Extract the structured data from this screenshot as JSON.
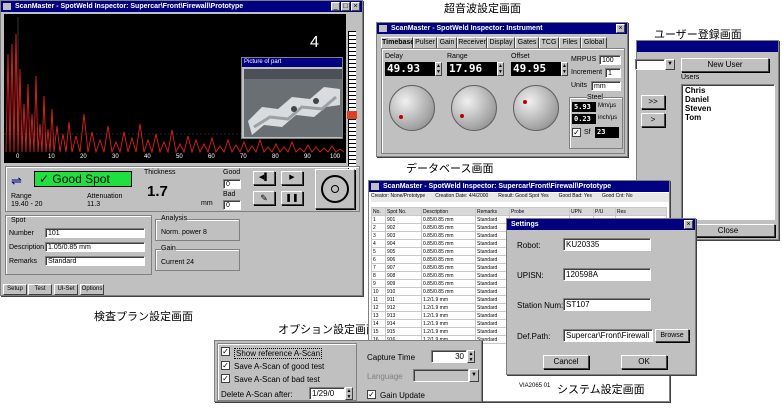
{
  "captions": {
    "ultrasonic": "超音波設定画面",
    "user": "ユーザー登録画面",
    "database": "データベース画面",
    "inspection": "検査プラン設定画面",
    "options": "オプション設定画面",
    "system": "システム設定画面"
  },
  "main": {
    "title": "ScanMaster - SpotWeld Inspector: Supercar\\Front\\Firewall\\Prototype",
    "spot_number": "4",
    "picture_title": "Picture of part",
    "x_ticks": [
      "0",
      "10",
      "20",
      "30",
      "40",
      "50",
      "60",
      "70",
      "80",
      "90",
      "100"
    ],
    "status": "Good Spot",
    "thickness_label": "Thickness",
    "thickness_value": "1.7",
    "thickness_unit": "mm",
    "range_labels": [
      "Range",
      "Attenuation"
    ],
    "range_values": [
      "19.40 - 20",
      "11.3"
    ],
    "good_label": "Good",
    "good_value": "0",
    "bad_label": "Bad",
    "bad_value": "0",
    "spot_group": "Spot",
    "spot_fields": [
      {
        "label": "Number",
        "value": "101"
      },
      {
        "label": "Description",
        "value": "1.05/0.85 mm"
      },
      {
        "label": "Remarks",
        "value": "Standard"
      }
    ],
    "analysis_group": "Analysis",
    "analysis_text": "Norm. power 8",
    "gain_group": "Gain",
    "gain_text": "Current 24",
    "tabs": [
      "Setup",
      "Test",
      "UI-Set",
      "Options"
    ]
  },
  "ultra": {
    "title": "ScanMaster - SpotWeld Inspector: Instrument",
    "tabs": [
      "Timebase",
      "Pulser",
      "Gain",
      "Receiver",
      "Display",
      "Gates",
      "TCG",
      "Files",
      "Global"
    ],
    "delay_label": "Delay",
    "delay_value": "49.93",
    "range_label": "Range",
    "range_value": "17.96",
    "offset_label": "Offset",
    "offset_value": "49.95",
    "mpus_label": "MRPUS",
    "mpus_value": "100",
    "increment_label": "Increment",
    "increment_value": "1",
    "units_label": "Units",
    "units_value": "mm",
    "steel_label": "Steel",
    "vel1_value": "5.93",
    "vel1_unit": "Mm/µs",
    "vel2_value": "0.23",
    "vel2_unit": "inch/µs",
    "sl_label": "Sf",
    "sl_value": "23"
  },
  "user": {
    "new_user": "New User",
    "users_label": "Users",
    "users": [
      "Chris",
      "Daniel",
      "Steven",
      "Tom"
    ],
    "move_right": ">>",
    "move_one": ">",
    "close": "Close"
  },
  "db": {
    "title": "ScanMaster - SpotWeld Inspector: Supercar\\Front\\Firewall\\Prototype",
    "info": [
      "Creator: None/Prototype",
      "Creation Date: 4/4/2000",
      "Result: Good Spot Yes",
      "Good Bad: Yes",
      "Good Cnt: No"
    ],
    "columns": [
      "No.",
      "Spot No.",
      "Description",
      "Remarks",
      "Probe",
      "UPN",
      "P/U",
      "Res"
    ],
    "rows": [
      [
        "1",
        "901",
        "0.85/0.85 mm",
        "Standard"
      ],
      [
        "2",
        "902",
        "0.85/0.85 mm",
        "Standard"
      ],
      [
        "3",
        "903",
        "0.85/0.85 mm",
        "Standard"
      ],
      [
        "4",
        "904",
        "0.85/0.85 mm",
        "Standard"
      ],
      [
        "5",
        "905",
        "0.85/0.85 mm",
        "Standard"
      ],
      [
        "6",
        "906",
        "0.85/0.85 mm",
        "Standard"
      ],
      [
        "7",
        "907",
        "0.85/0.85 mm",
        "Standard"
      ],
      [
        "8",
        "908",
        "0.85/0.85 mm",
        "Standard"
      ],
      [
        "9",
        "909",
        "0.85/0.85 mm",
        "Standard"
      ],
      [
        "10",
        "910",
        "0.85/0.85 mm",
        "Standard"
      ],
      [
        "11",
        "911",
        "1.2/1.9 mm",
        "Standard"
      ],
      [
        "12",
        "912",
        "1.2/1.9 mm",
        "Standard"
      ],
      [
        "13",
        "913",
        "1.2/1.9 mm",
        "Standard"
      ],
      [
        "14",
        "914",
        "1.2/1.9 mm",
        "Standard"
      ],
      [
        "15",
        "915",
        "1.2/1.9 mm",
        "Standard"
      ],
      [
        "16",
        "916",
        "1.2/1.9 mm",
        "Standard"
      ]
    ],
    "footer": "VIA2065 01"
  },
  "settings": {
    "title": "Settings",
    "robot_label": "Robot:",
    "robot_value": "KU20335",
    "upsn_label": "UPISN:",
    "upsn_value": "120598A",
    "station_label": "Station Num:",
    "station_value": "ST107",
    "dbpath_label": "Def.Path:",
    "dbpath_value": "Supercar\\Front\\Firewall",
    "browse": "Browse",
    "cancel": "Cancel",
    "ok": "OK"
  },
  "opts": {
    "show_ref": "Show reference A-Scan",
    "save_good": "Save A-Scan of good test",
    "save_bad": "Save A-Scan of bad test",
    "delete_label": "Delete A-Scan after:",
    "delete_value": "1/29/0",
    "capture_label": "Capture Time",
    "capture_value": "30",
    "lang_label": "Language",
    "gain_update": "Gain Update"
  }
}
